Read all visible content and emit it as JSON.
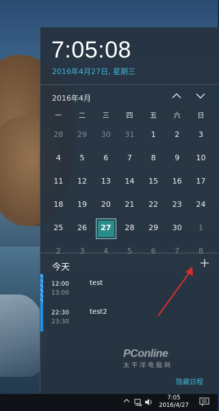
{
  "clock": {
    "time": "7:05:08",
    "date_long": "2016年4月27日, 星期三"
  },
  "calendar": {
    "month_label": "2016年4月",
    "weekdays": [
      "一",
      "二",
      "三",
      "四",
      "五",
      "六",
      "日"
    ],
    "weeks": [
      [
        "28",
        "29",
        "30",
        "31",
        "1",
        "2",
        "3"
      ],
      [
        "4",
        "5",
        "6",
        "7",
        "8",
        "9",
        "10"
      ],
      [
        "11",
        "12",
        "13",
        "14",
        "15",
        "16",
        "17"
      ],
      [
        "18",
        "19",
        "20",
        "21",
        "22",
        "23",
        "24"
      ],
      [
        "25",
        "26",
        "27",
        "28",
        "29",
        "30",
        "1"
      ],
      [
        "2",
        "3",
        "4",
        "5",
        "6",
        "7",
        "8"
      ]
    ],
    "today": "27"
  },
  "agenda": {
    "title": "今天",
    "add_icon": "plus-icon",
    "events": [
      {
        "start": "12:00",
        "end": "13:00",
        "title": "test"
      },
      {
        "start": "22:30",
        "end": "23:30",
        "title": "test2"
      }
    ],
    "hide_label": "隐藏日程"
  },
  "watermark": {
    "main": "PConline",
    "sub": "太平洋电脑网"
  },
  "taskbar": {
    "time": "7:05",
    "date": "2016/4/27"
  },
  "colors": {
    "accent": "#40b6d8",
    "today_fill": "#2a8c8c",
    "event_bar": "#1e90e8",
    "annotation_arrow": "#d32f2f"
  }
}
